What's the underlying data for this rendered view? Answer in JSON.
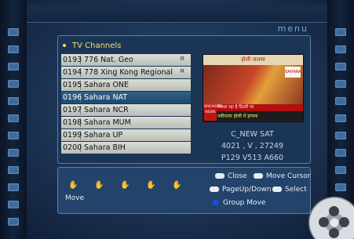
{
  "header": {
    "menu_label": "menu"
  },
  "list": {
    "title": "TV Channels",
    "channels": [
      {
        "num": "0193",
        "name": "776 Nat. Geo",
        "sym": "¤",
        "selected": false
      },
      {
        "num": "0194",
        "name": "778 Xing Kong Regional",
        "sym": "¤",
        "selected": false
      },
      {
        "num": "0195",
        "name": "Sahara ONE",
        "sym": "",
        "selected": false
      },
      {
        "num": "0196",
        "name": "Sahara NAT",
        "sym": "",
        "selected": true
      },
      {
        "num": "0197",
        "name": "Sahara NCR",
        "sym": "",
        "selected": false
      },
      {
        "num": "0198",
        "name": "Sahara MUM",
        "sym": "",
        "selected": false
      },
      {
        "num": "0199",
        "name": "Sahara UP",
        "sym": "",
        "selected": false
      },
      {
        "num": "0200",
        "name": "Sahara BIH",
        "sym": "",
        "selected": false
      }
    ]
  },
  "preview": {
    "top_text": "होली जलसा",
    "caption1": "निकल रहा है दिल्ली पर",
    "caption2": "नवीनतम होली में हंगामा",
    "badge": "BREAKING NEWS",
    "logo": "SAHARA"
  },
  "info": {
    "satellite": "C_NEW SAT",
    "freq_line": "4021 , V , 27249",
    "pid_line": "P129 V513 A660"
  },
  "help": {
    "move_label": "Move",
    "close_label": "Close",
    "move_cursor_label": "Move Cursor",
    "page_label": "PageUp/Down",
    "select_label": "Select",
    "group_move_label": "Group Move"
  }
}
